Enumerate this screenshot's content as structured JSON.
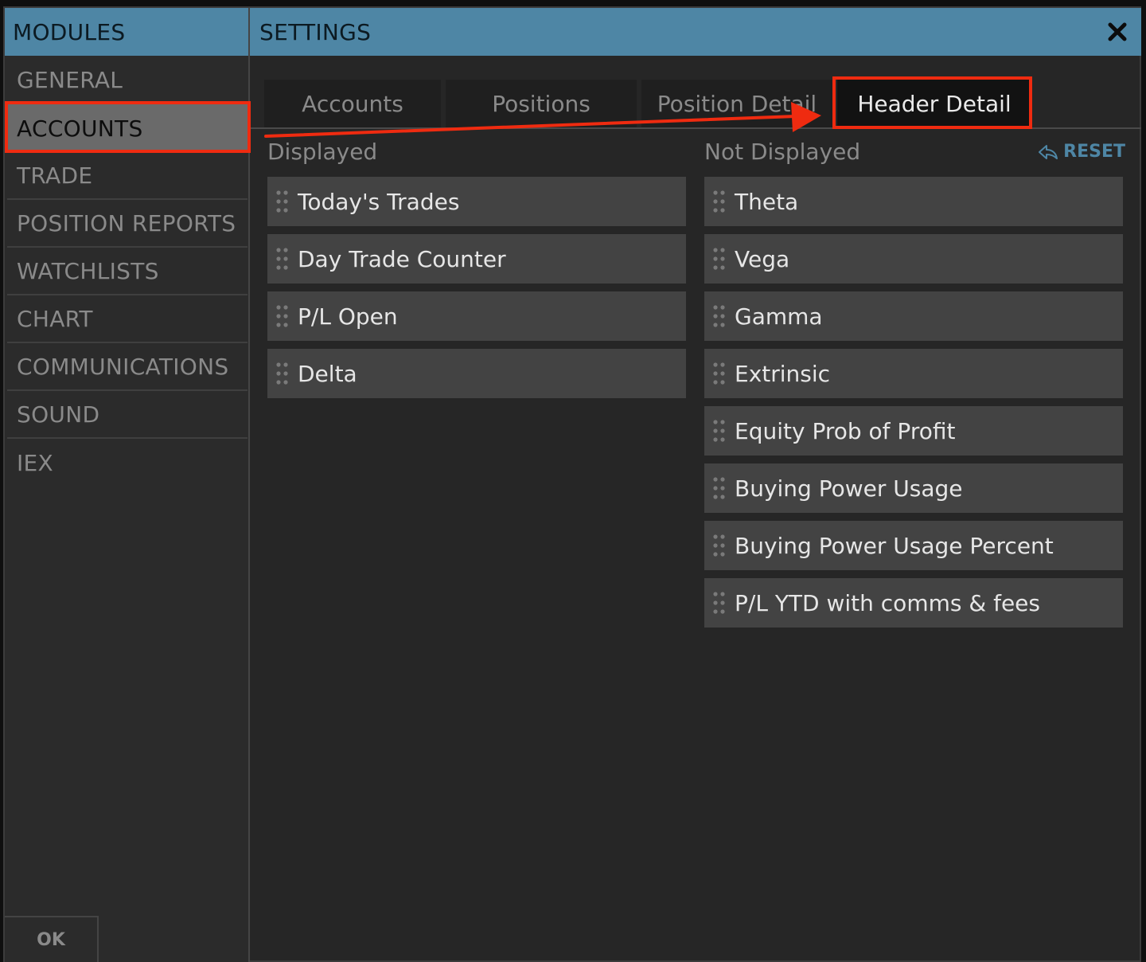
{
  "sidebar": {
    "header": "MODULES",
    "items": [
      {
        "label": "GENERAL"
      },
      {
        "label": "ACCOUNTS"
      },
      {
        "label": "TRADE"
      },
      {
        "label": "POSITION REPORTS"
      },
      {
        "label": "WATCHLISTS"
      },
      {
        "label": "CHART"
      },
      {
        "label": "COMMUNICATIONS"
      },
      {
        "label": "SOUND"
      },
      {
        "label": "IEX"
      }
    ],
    "ok_label": "OK"
  },
  "main": {
    "header": "SETTINGS",
    "close_icon": "close-icon",
    "tabs": [
      {
        "label": "Accounts"
      },
      {
        "label": "Positions"
      },
      {
        "label": "Position Detail"
      },
      {
        "label": "Header Detail"
      }
    ],
    "active_tab": "Header Detail",
    "displayed_label": "Displayed",
    "not_displayed_label": "Not Displayed",
    "reset_label": "RESET",
    "reset_icon": "reply-arrow-icon",
    "displayed": [
      "Today's Trades",
      "Day Trade Counter",
      "P/L Open",
      "Delta"
    ],
    "not_displayed": [
      "Theta",
      "Vega",
      "Gamma",
      "Extrinsic",
      "Equity Prob of Profit",
      "Buying Power Usage",
      "Buying Power Usage Percent",
      "P/L YTD with comms & fees"
    ]
  },
  "colors": {
    "header_blue": "#4e86a5",
    "annotation_red": "#ef2b10",
    "field_bg": "#434343",
    "panel_bg": "#262626"
  }
}
